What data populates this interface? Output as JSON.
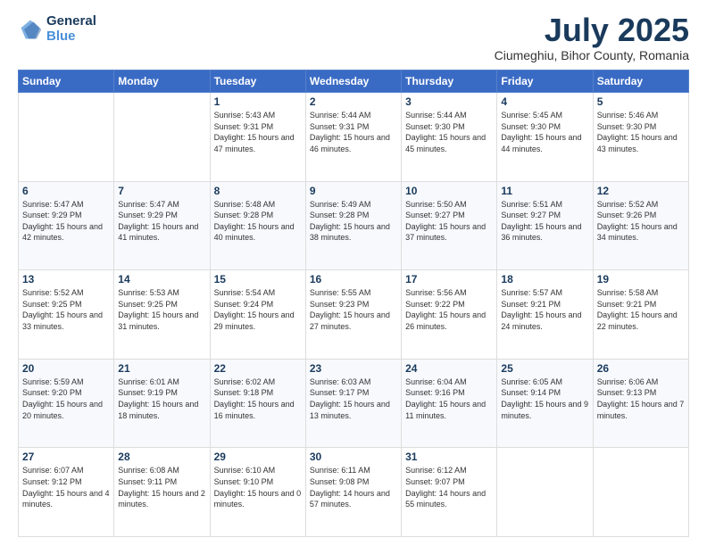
{
  "logo": {
    "line1": "General",
    "line2": "Blue"
  },
  "title": {
    "month_year": "July 2025",
    "location": "Ciumeghiu, Bihor County, Romania"
  },
  "days_of_week": [
    "Sunday",
    "Monday",
    "Tuesday",
    "Wednesday",
    "Thursday",
    "Friday",
    "Saturday"
  ],
  "weeks": [
    [
      {
        "day": "",
        "info": ""
      },
      {
        "day": "",
        "info": ""
      },
      {
        "day": "1",
        "info": "Sunrise: 5:43 AM\nSunset: 9:31 PM\nDaylight: 15 hours and 47 minutes."
      },
      {
        "day": "2",
        "info": "Sunrise: 5:44 AM\nSunset: 9:31 PM\nDaylight: 15 hours and 46 minutes."
      },
      {
        "day": "3",
        "info": "Sunrise: 5:44 AM\nSunset: 9:30 PM\nDaylight: 15 hours and 45 minutes."
      },
      {
        "day": "4",
        "info": "Sunrise: 5:45 AM\nSunset: 9:30 PM\nDaylight: 15 hours and 44 minutes."
      },
      {
        "day": "5",
        "info": "Sunrise: 5:46 AM\nSunset: 9:30 PM\nDaylight: 15 hours and 43 minutes."
      }
    ],
    [
      {
        "day": "6",
        "info": "Sunrise: 5:47 AM\nSunset: 9:29 PM\nDaylight: 15 hours and 42 minutes."
      },
      {
        "day": "7",
        "info": "Sunrise: 5:47 AM\nSunset: 9:29 PM\nDaylight: 15 hours and 41 minutes."
      },
      {
        "day": "8",
        "info": "Sunrise: 5:48 AM\nSunset: 9:28 PM\nDaylight: 15 hours and 40 minutes."
      },
      {
        "day": "9",
        "info": "Sunrise: 5:49 AM\nSunset: 9:28 PM\nDaylight: 15 hours and 38 minutes."
      },
      {
        "day": "10",
        "info": "Sunrise: 5:50 AM\nSunset: 9:27 PM\nDaylight: 15 hours and 37 minutes."
      },
      {
        "day": "11",
        "info": "Sunrise: 5:51 AM\nSunset: 9:27 PM\nDaylight: 15 hours and 36 minutes."
      },
      {
        "day": "12",
        "info": "Sunrise: 5:52 AM\nSunset: 9:26 PM\nDaylight: 15 hours and 34 minutes."
      }
    ],
    [
      {
        "day": "13",
        "info": "Sunrise: 5:52 AM\nSunset: 9:25 PM\nDaylight: 15 hours and 33 minutes."
      },
      {
        "day": "14",
        "info": "Sunrise: 5:53 AM\nSunset: 9:25 PM\nDaylight: 15 hours and 31 minutes."
      },
      {
        "day": "15",
        "info": "Sunrise: 5:54 AM\nSunset: 9:24 PM\nDaylight: 15 hours and 29 minutes."
      },
      {
        "day": "16",
        "info": "Sunrise: 5:55 AM\nSunset: 9:23 PM\nDaylight: 15 hours and 27 minutes."
      },
      {
        "day": "17",
        "info": "Sunrise: 5:56 AM\nSunset: 9:22 PM\nDaylight: 15 hours and 26 minutes."
      },
      {
        "day": "18",
        "info": "Sunrise: 5:57 AM\nSunset: 9:21 PM\nDaylight: 15 hours and 24 minutes."
      },
      {
        "day": "19",
        "info": "Sunrise: 5:58 AM\nSunset: 9:21 PM\nDaylight: 15 hours and 22 minutes."
      }
    ],
    [
      {
        "day": "20",
        "info": "Sunrise: 5:59 AM\nSunset: 9:20 PM\nDaylight: 15 hours and 20 minutes."
      },
      {
        "day": "21",
        "info": "Sunrise: 6:01 AM\nSunset: 9:19 PM\nDaylight: 15 hours and 18 minutes."
      },
      {
        "day": "22",
        "info": "Sunrise: 6:02 AM\nSunset: 9:18 PM\nDaylight: 15 hours and 16 minutes."
      },
      {
        "day": "23",
        "info": "Sunrise: 6:03 AM\nSunset: 9:17 PM\nDaylight: 15 hours and 13 minutes."
      },
      {
        "day": "24",
        "info": "Sunrise: 6:04 AM\nSunset: 9:16 PM\nDaylight: 15 hours and 11 minutes."
      },
      {
        "day": "25",
        "info": "Sunrise: 6:05 AM\nSunset: 9:14 PM\nDaylight: 15 hours and 9 minutes."
      },
      {
        "day": "26",
        "info": "Sunrise: 6:06 AM\nSunset: 9:13 PM\nDaylight: 15 hours and 7 minutes."
      }
    ],
    [
      {
        "day": "27",
        "info": "Sunrise: 6:07 AM\nSunset: 9:12 PM\nDaylight: 15 hours and 4 minutes."
      },
      {
        "day": "28",
        "info": "Sunrise: 6:08 AM\nSunset: 9:11 PM\nDaylight: 15 hours and 2 minutes."
      },
      {
        "day": "29",
        "info": "Sunrise: 6:10 AM\nSunset: 9:10 PM\nDaylight: 15 hours and 0 minutes."
      },
      {
        "day": "30",
        "info": "Sunrise: 6:11 AM\nSunset: 9:08 PM\nDaylight: 14 hours and 57 minutes."
      },
      {
        "day": "31",
        "info": "Sunrise: 6:12 AM\nSunset: 9:07 PM\nDaylight: 14 hours and 55 minutes."
      },
      {
        "day": "",
        "info": ""
      },
      {
        "day": "",
        "info": ""
      }
    ]
  ]
}
